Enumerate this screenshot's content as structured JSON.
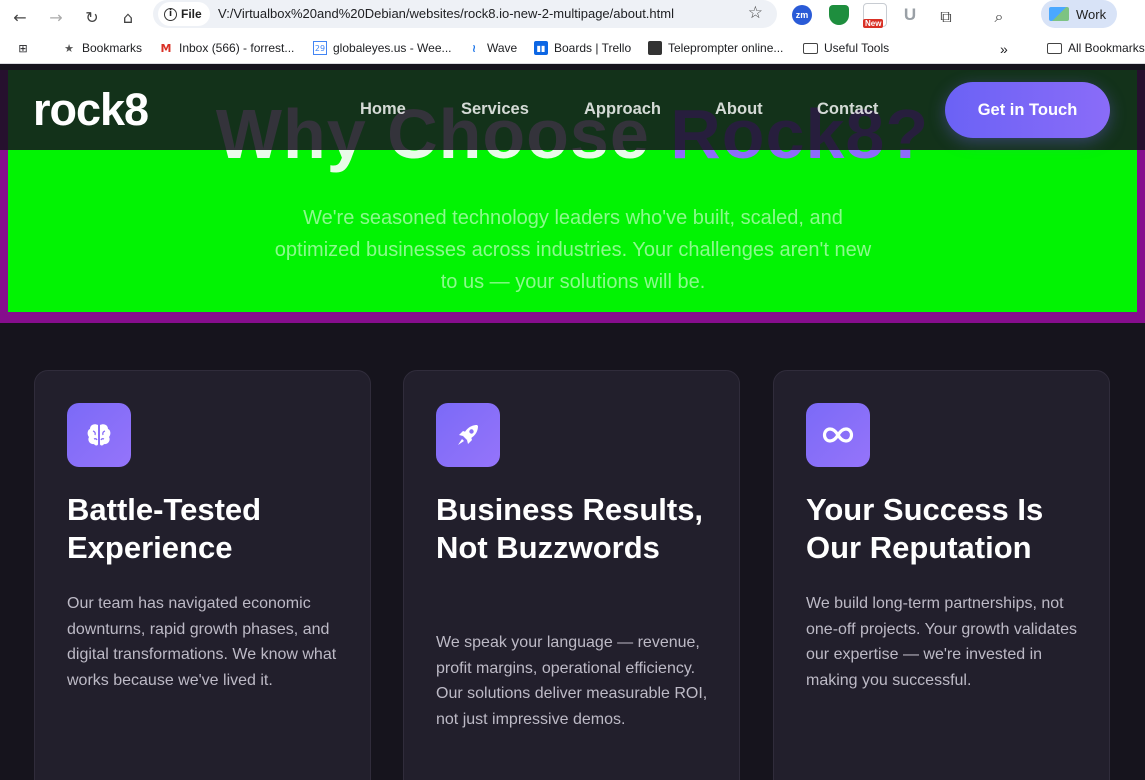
{
  "browser": {
    "file_label": "File",
    "url": "V:/Virtualbox%20and%20Debian/websites/rock8.io-new-2-multipage/about.html",
    "profile_label": "Work",
    "extensions": [
      {
        "name": "zm",
        "label": "zm",
        "color": "#2a5bd7"
      },
      {
        "name": "shield",
        "label": "",
        "color": "#1e8e3e"
      },
      {
        "name": "new",
        "label": "New",
        "color": "#d93025"
      },
      {
        "name": "u",
        "label": "U",
        "color": "#9aa0a6"
      }
    ],
    "bookmarks": [
      {
        "label": "Bookmarks",
        "icon": "star-icon"
      },
      {
        "label": "Inbox (566) - forrest...",
        "icon": "gmail-icon"
      },
      {
        "label": "globaleyes.us - Wee...",
        "icon": "calendar-icon"
      },
      {
        "label": "Wave",
        "icon": "wave-icon"
      },
      {
        "label": "Boards | Trello",
        "icon": "trello-icon"
      },
      {
        "label": "Teleprompter online...",
        "icon": "monitor-icon"
      },
      {
        "label": "Useful Tools",
        "icon": "folder-icon"
      }
    ],
    "all_bookmarks_label": "All Bookmarks"
  },
  "nav": {
    "logo": "rock8",
    "links": [
      "Home",
      "Services",
      "Approach",
      "About",
      "Contact"
    ],
    "cta": "Get in Touch"
  },
  "hero": {
    "heading_main": "Why Choose",
    "heading_accent": "Rock8?",
    "subtitle": "We're seasoned technology leaders who've built, scaled, and optimized businesses across industries. Your challenges aren't new to us — your solutions will be.",
    "colors": {
      "band": "#860d8d",
      "fill": "#02f303",
      "accent": "#8d6cf9"
    }
  },
  "cards": [
    {
      "icon": "brain-icon",
      "title": "Battle-Tested Experience",
      "text": "Our team has navigated economic downturns, rapid growth phases, and digital transformations. We know what works because we've lived it."
    },
    {
      "icon": "rocket-icon",
      "title": "Business Results, Not Buzzwords",
      "text": "We speak your language — revenue, profit margins, operational efficiency. Our solutions deliver measurable ROI, not just impressive demos."
    },
    {
      "icon": "infinity-icon",
      "title": "Your Success Is Our Reputation",
      "text": "We build long-term partnerships, not one-off projects. Your growth validates our expertise — we're invested in making you successful."
    }
  ]
}
